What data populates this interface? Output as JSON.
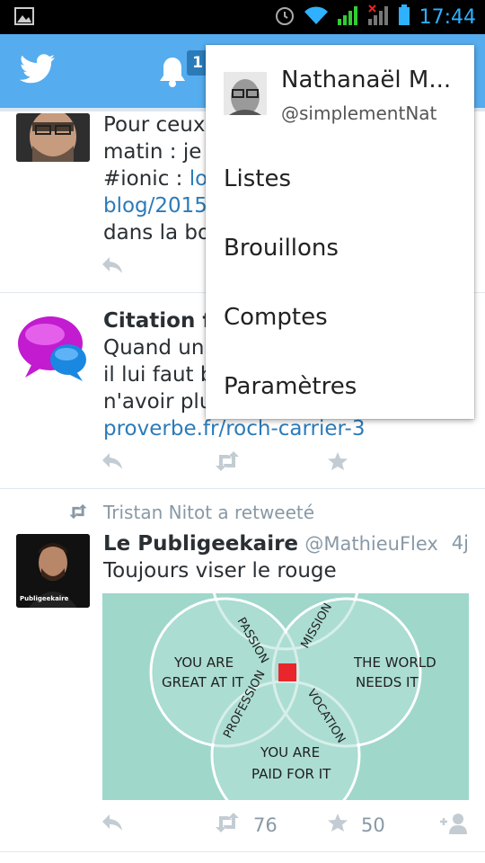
{
  "status_bar": {
    "time": "17:44"
  },
  "header": {
    "notifications_badge": "1"
  },
  "tweets": [
    {
      "text_line1": "Pour ceux",
      "text_line2": "matin : je",
      "text_line3_plain": "#ionic : ",
      "text_line3_link": "lo",
      "text_line4_link": "blog/2015",
      "text_line5": "dans la bo"
    },
    {
      "name": "Citation fr",
      "text_line1": "Quand un",
      "text_line2": "il lui faut b",
      "text_line3": "n'avoir plu",
      "link": "proverbe.fr/roch-carrier-3"
    },
    {
      "retweeted_by": "Tristan Nitot a retweeté",
      "name": "Le Publigeekaire",
      "handle": "@MathieuFlex",
      "time": "4j",
      "text": "Toujours viser le rouge",
      "avatar_caption": "Publigeekaire",
      "image_labels": {
        "great": [
          "YOU ARE",
          "GREAT AT IT"
        ],
        "world": [
          "THE WORLD",
          "NEEDS IT"
        ],
        "paid": [
          "YOU ARE",
          "PAID FOR IT"
        ],
        "passion": "PASSION",
        "mission": "MISSION",
        "profession": "PROFESSION",
        "vocation": "VOCATION"
      },
      "retweets": "76",
      "favorites": "50"
    }
  ],
  "menu": {
    "name": "Nathanaël M...",
    "handle": "@simplementNat",
    "items": [
      "Listes",
      "Brouillons",
      "Comptes",
      "Paramètres"
    ]
  },
  "colors": {
    "header": "#55acee",
    "link": "#2b7bb9",
    "venn_bg": "#9fd7cb",
    "center": "#e8262b"
  }
}
